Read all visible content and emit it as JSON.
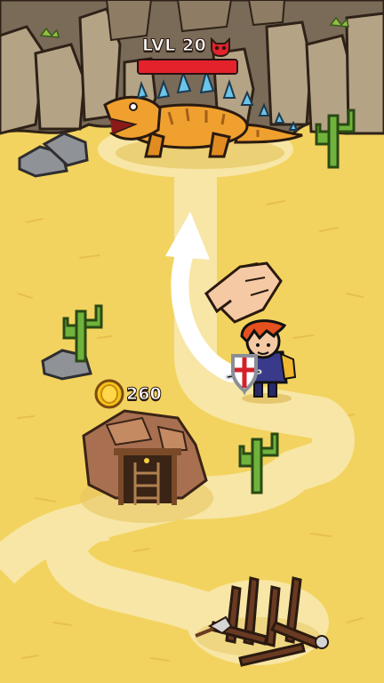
{
  "hud": {
    "level_label": "LVL 20",
    "boss_icon": "red-skull-icon",
    "health_fraction": 1.0,
    "health_color": "#e4222b"
  },
  "reward": {
    "coin_icon": "gold-coin-icon",
    "amount": "260"
  },
  "colors": {
    "sand": "#f3d35f",
    "path": "#f7e6a5",
    "rock": "#7a6a58",
    "cactus": "#6fb33c"
  },
  "scene": {
    "boss": "spiky-orange-lizard",
    "hero": "red-haired-knight",
    "hint": "pointing-hand-with-arrow",
    "buildings": [
      "mine-entrance",
      "broken-wooden-hut"
    ]
  }
}
